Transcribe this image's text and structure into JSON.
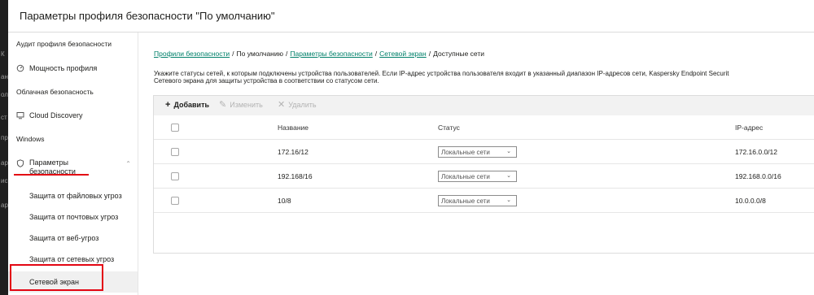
{
  "window": {
    "title": "Параметры профиля безопасности \"По умолчанию\"",
    "left_strip_chars": [
      "К",
      "ан",
      "ол",
      "ст",
      "пр",
      "ар",
      "ис",
      "ар"
    ]
  },
  "sidebar": {
    "sections": {
      "audit": "Аудит профиля безопасности",
      "cloud": "Облачная безопасность",
      "windows": "Windows"
    },
    "items": {
      "profile_power": "Мощность профиля",
      "cloud_discovery": "Cloud Discovery",
      "security_params": "Параметры безопасности"
    },
    "sub_items": [
      "Защита от файловых угроз",
      "Защита от почтовых угроз",
      "Защита от веб-угроз",
      "Защита от сетевых угроз",
      "Сетевой экран"
    ]
  },
  "breadcrumb": {
    "items": [
      "Профили безопасности",
      "По умолчанию",
      "Параметры безопасности",
      "Сетевой экран",
      "Доступные сети"
    ],
    "separator": "/"
  },
  "description": {
    "line1": "Укажите статусы сетей, к которым подключены устройства пользователей. Если IP-адрес устройства пользователя входит в указанный диапазон IP-адресов сети, Kaspersky Endpoint Securit",
    "line2": "Сетевого экрана для защиты устройства в соответствии со статусом сети."
  },
  "toolbar": {
    "add": "Добавить",
    "edit": "Изменить",
    "delete": "Удалить"
  },
  "table": {
    "columns": [
      "Название",
      "Статус",
      "IP-адрес"
    ],
    "rows": [
      {
        "name": "172.16/12",
        "status": "Локальные сети",
        "ip": "172.16.0.0/12"
      },
      {
        "name": "192.168/16",
        "status": "Локальные сети",
        "ip": "192.168.0.0/16"
      },
      {
        "name": "10/8",
        "status": "Локальные сети",
        "ip": "10.0.0.0/8"
      }
    ]
  },
  "colors": {
    "link": "#00806a",
    "highlight": "#e30613",
    "toolbar_bg": "#f2f2f2"
  }
}
